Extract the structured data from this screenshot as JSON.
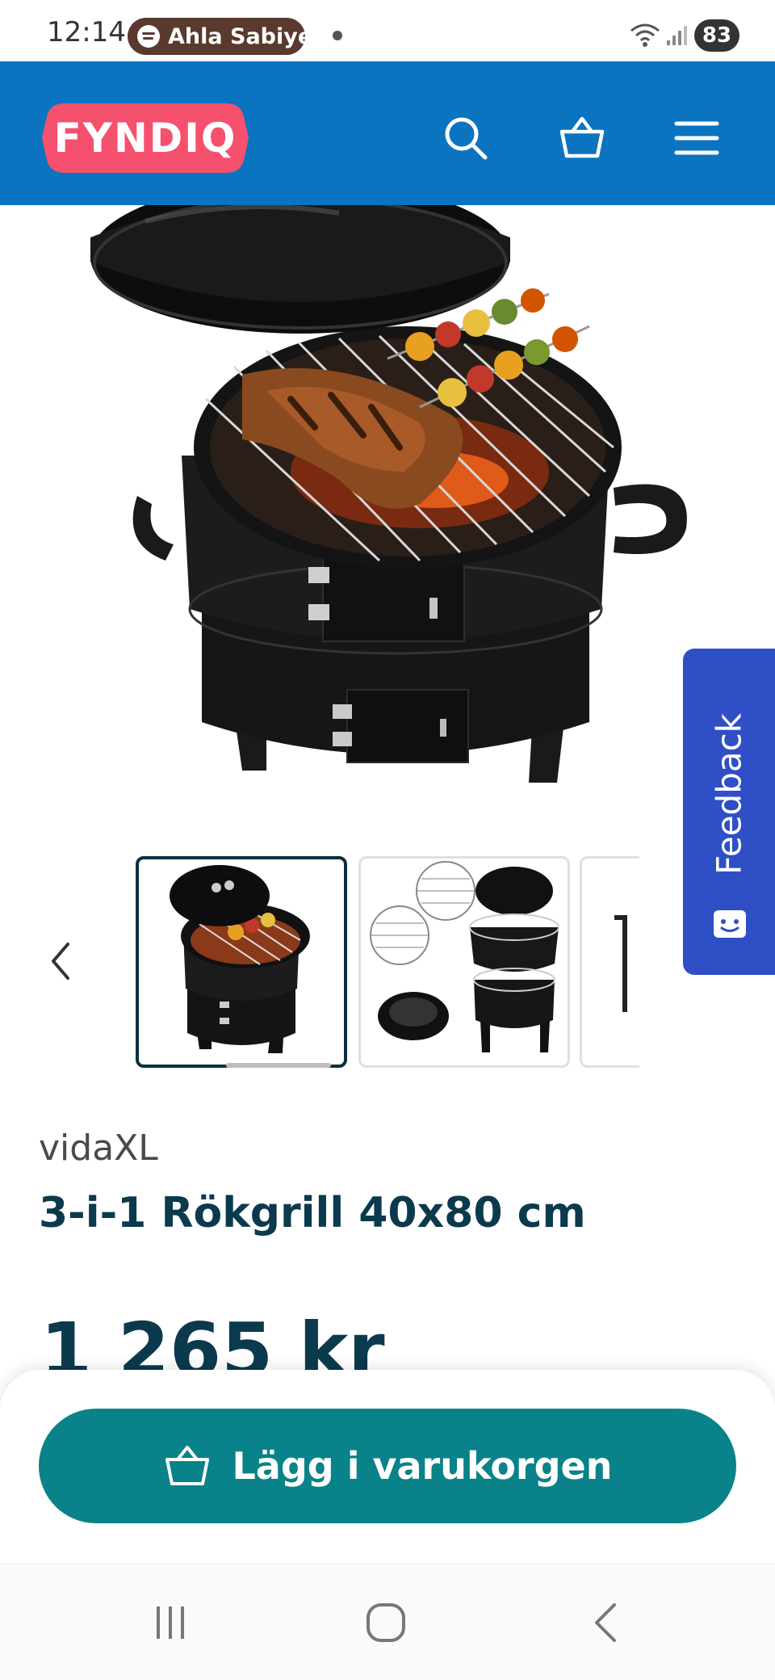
{
  "status_bar": {
    "time": "12:14",
    "media_text": "Ahla Sabiye",
    "battery": "83"
  },
  "header": {
    "logo_text": "FYNDIQ",
    "icons": [
      "search-icon",
      "cart-icon",
      "menu-icon"
    ]
  },
  "feedback": {
    "label": "Feedback"
  },
  "product": {
    "brand": "vidaXL",
    "title": "3-i-1 Rökgrill 40x80 cm",
    "price": "1 265 kr"
  },
  "cta": {
    "add_to_cart_label": "Lägg i varukorgen"
  },
  "colors": {
    "header_bg": "#0a74c0",
    "logo_bg": "#f5506e",
    "feedback_bg": "#2f4fc7",
    "cta_bg": "#0a8289",
    "text_dark": "#0b3a4d"
  }
}
